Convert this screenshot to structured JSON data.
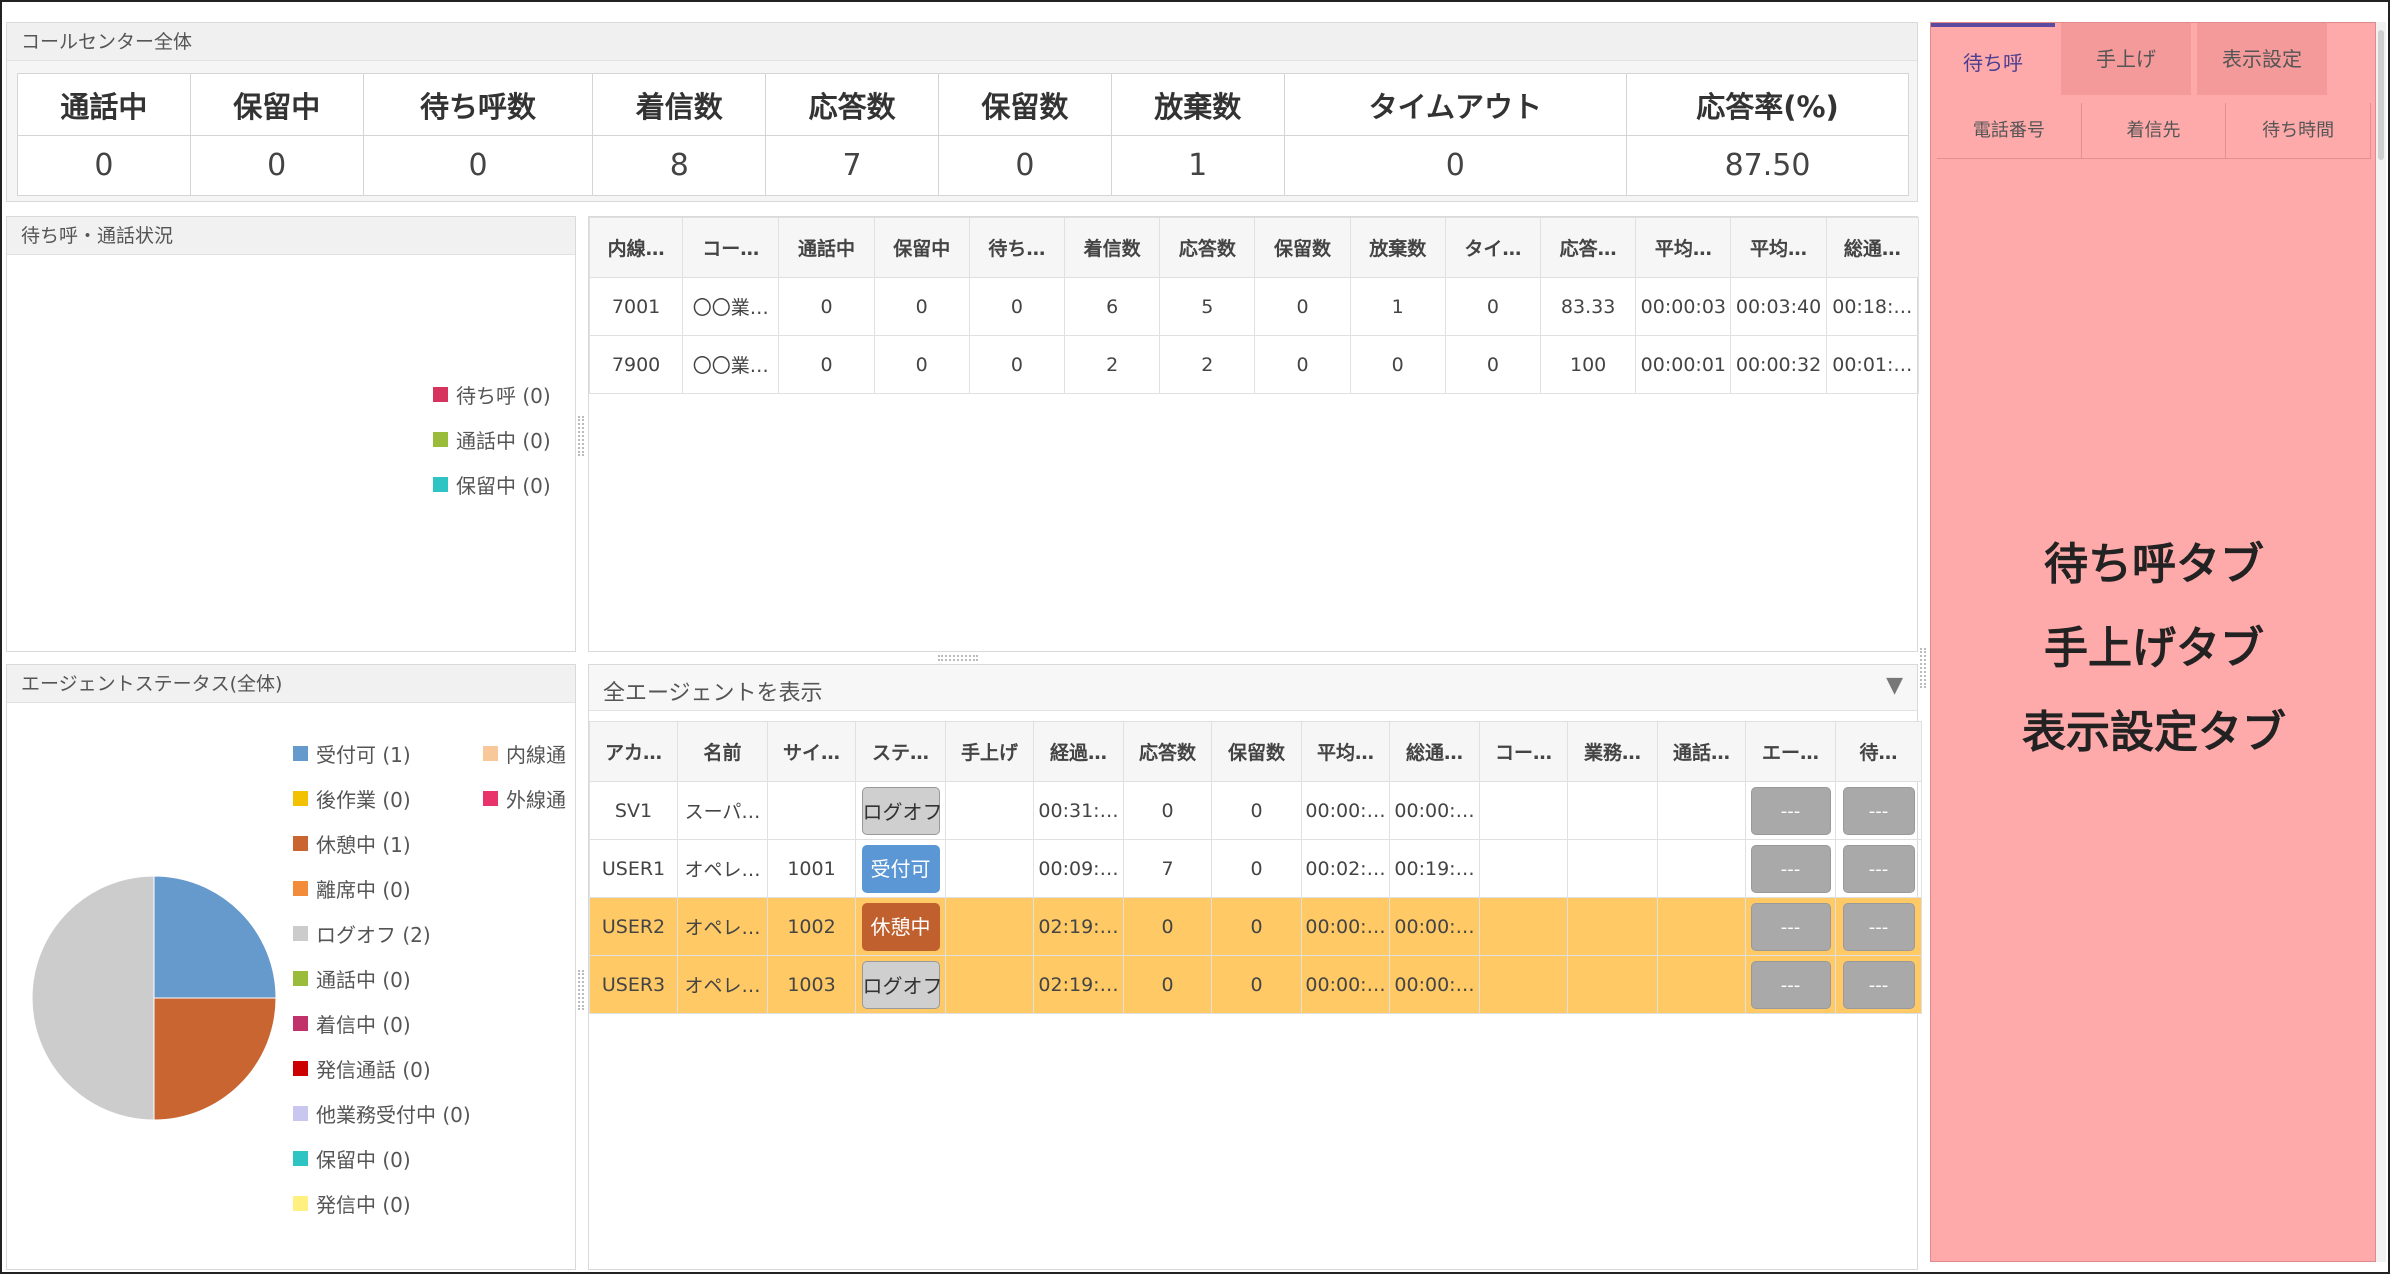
{
  "summary": {
    "title": "コールセンター全体",
    "headers": [
      "通話中",
      "保留中",
      "待ち呼数",
      "着信数",
      "応答数",
      "保留数",
      "放棄数",
      "タイムアウト",
      "応答率(%)"
    ],
    "values": [
      "0",
      "0",
      "0",
      "8",
      "7",
      "0",
      "1",
      "0",
      "87.50"
    ]
  },
  "call_status": {
    "title": "待ち呼・通話状況",
    "legend": [
      {
        "label": "待ち呼 (0)",
        "color": "#d6335e"
      },
      {
        "label": "通話中 (0)",
        "color": "#9bbb3b"
      },
      {
        "label": "保留中 (0)",
        "color": "#2fc4c4"
      }
    ]
  },
  "extension_table": {
    "headers": [
      "内線…",
      "コー…",
      "通話中",
      "保留中",
      "待ち…",
      "着信数",
      "応答数",
      "保留数",
      "放棄数",
      "タイ…",
      "応答…",
      "平均…",
      "平均…",
      "総通…"
    ],
    "rows": [
      [
        "7001",
        "〇〇業…",
        "0",
        "0",
        "0",
        "6",
        "5",
        "0",
        "1",
        "0",
        "83.33",
        "00:00:03",
        "00:03:40",
        "00:18:…"
      ],
      [
        "7900",
        "〇〇業…",
        "0",
        "0",
        "0",
        "2",
        "2",
        "0",
        "0",
        "0",
        "100",
        "00:00:01",
        "00:00:32",
        "00:01:…"
      ]
    ]
  },
  "agent_overall": {
    "title": "エージェントステータス(全体)",
    "legend_col1": [
      {
        "label": "受付可 (1)",
        "color": "#6699cc"
      },
      {
        "label": "後作業 (0)",
        "color": "#f2c200"
      },
      {
        "label": "休憩中 (1)",
        "color": "#c96531"
      },
      {
        "label": "離席中 (0)",
        "color": "#f28c3a"
      },
      {
        "label": "ログオフ (2)",
        "color": "#cccccc"
      },
      {
        "label": "通話中 (0)",
        "color": "#9bbb3b"
      },
      {
        "label": "着信中 (0)",
        "color": "#c2326a"
      },
      {
        "label": "発信通話 (0)",
        "color": "#cc0000"
      },
      {
        "label": "他業務受付中 (0)",
        "color": "#c9c6f0"
      },
      {
        "label": "保留中 (0)",
        "color": "#2fc4c4"
      },
      {
        "label": "発信中 (0)",
        "color": "#fff080"
      }
    ],
    "legend_col2": [
      {
        "label": "内線通",
        "color": "#f9c89a"
      },
      {
        "label": "外線通",
        "color": "#e8336b"
      }
    ],
    "pie": [
      {
        "label": "受付可",
        "value": 1,
        "color": "#6699cc"
      },
      {
        "label": "休憩中",
        "value": 1,
        "color": "#c96531"
      },
      {
        "label": "ログオフ",
        "value": 2,
        "color": "#cccccc"
      }
    ]
  },
  "agents": {
    "filter_label": "全エージェントを表示",
    "filter_arrow": "▼",
    "headers": [
      "アカ…",
      "名前",
      "サイ…",
      "ステ…",
      "手上げ",
      "経過…",
      "応答数",
      "保留数",
      "平均…",
      "総通…",
      "コー…",
      "業務…",
      "通話…",
      "エー…",
      "待…"
    ],
    "rows": [
      {
        "account": "SV1",
        "name": "スーパ…",
        "seat": "",
        "status": "ログオフ",
        "status_type": "logoff",
        "raise": "",
        "elapsed": "00:31:…",
        "answered": "0",
        "held": "0",
        "avg": "00:00:…",
        "total": "00:00:…",
        "btn1": "---",
        "btn2": "---",
        "highlight": false
      },
      {
        "account": "USER1",
        "name": "オペレ…",
        "seat": "1001",
        "status": "受付可",
        "status_type": "ok",
        "raise": "",
        "elapsed": "00:09:…",
        "answered": "7",
        "held": "0",
        "avg": "00:02:…",
        "total": "00:19:…",
        "btn1": "---",
        "btn2": "---",
        "highlight": false
      },
      {
        "account": "USER2",
        "name": "オペレ…",
        "seat": "1002",
        "status": "休憩中",
        "status_type": "rest",
        "raise": "",
        "elapsed": "02:19:…",
        "answered": "0",
        "held": "0",
        "avg": "00:00:…",
        "total": "00:00:…",
        "btn1": "---",
        "btn2": "---",
        "highlight": true
      },
      {
        "account": "USER3",
        "name": "オペレ…",
        "seat": "1003",
        "status": "ログオフ",
        "status_type": "logoff",
        "raise": "",
        "elapsed": "02:19:…",
        "answered": "0",
        "held": "0",
        "avg": "00:00:…",
        "total": "00:00:…",
        "btn1": "---",
        "btn2": "---",
        "highlight": true
      }
    ]
  },
  "right_panel": {
    "tabs": [
      "待ち呼",
      "手上げ",
      "表示設定"
    ],
    "active_tab": 0,
    "subheaders": [
      "電話番号",
      "着信先",
      "待ち時間"
    ],
    "annotation_lines": [
      "待ち呼タブ",
      "手上げタブ",
      "表示設定タブ"
    ]
  }
}
